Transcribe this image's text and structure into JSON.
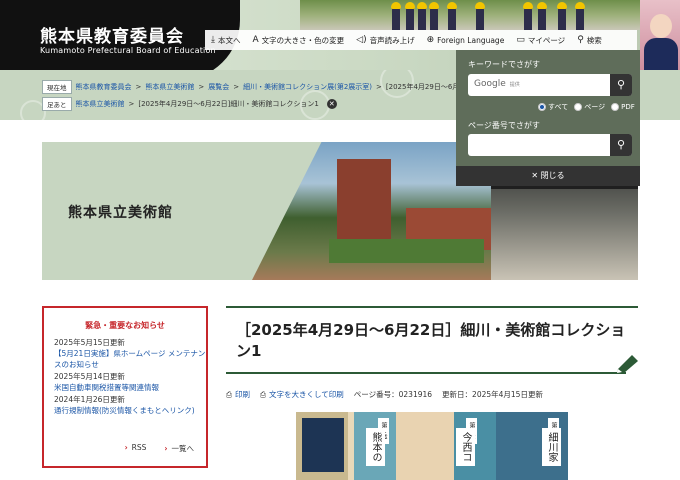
{
  "header": {
    "logo_title": "熊本県教育委員会",
    "logo_subtitle": "Kumamoto Prefectural Board of Education"
  },
  "utility": {
    "items": [
      {
        "icon": "download-icon",
        "label": "本文へ"
      },
      {
        "icon": "text-size-icon",
        "label": "文字の大きさ・色の変更"
      },
      {
        "icon": "speaker-icon",
        "label": "音声読み上げ"
      },
      {
        "icon": "globe-icon",
        "label": "Foreign Language"
      },
      {
        "icon": "folder-icon",
        "label": "マイページ"
      },
      {
        "icon": "search-icon",
        "label": "検索"
      }
    ]
  },
  "breadcrumb": {
    "current_tag": "現在地",
    "path": [
      "熊本県教育委員会",
      "熊本県立美術館",
      "展覧会",
      "細川・美術館コレクション展(第2展示室)",
      "[2025年4月29日～6月22日]細川・美術館コ"
    ],
    "history_tag": "足あと",
    "history": [
      "熊本県立美術館",
      "[2025年4月29日～6月22日]細川・美術館コレクション1"
    ]
  },
  "search_popup": {
    "keyword_label": "キーワードでさがす",
    "google_label": "Google",
    "google_sub": "提供",
    "options": [
      {
        "label": "すべて",
        "selected": true
      },
      {
        "label": "ページ",
        "selected": false
      },
      {
        "label": "PDF",
        "selected": false
      }
    ],
    "page_number_label": "ページ番号でさがす",
    "close_label": "閉じる"
  },
  "banner": {
    "title": "熊本県立美術館"
  },
  "notice": {
    "title": "緊急・重要なお知らせ",
    "items": [
      {
        "date": "2025年5月15日更新",
        "text": "【5月21日実施】県ホームページ メンテナンスのお知らせ"
      },
      {
        "date": "2025年5月14日更新",
        "text": "米国自動車関税措置等関連情報"
      },
      {
        "date": "2024年1月26日更新",
        "text": "通行規制情報(防災情報くまもとヘリンク)"
      }
    ],
    "rss_label": "RSS",
    "list_label": "一覧へ"
  },
  "article": {
    "title": "［2025年4月29日～6月22日］細川・美術館コレクション1",
    "print_label": "印刷",
    "print_large_label": "文字を大きくして印刷",
    "page_number": "ページ番号：0231916",
    "updated": "更新日：2025年4月15日更新"
  },
  "poster": {
    "labels": [
      "第１章",
      "第２章",
      "第３章"
    ],
    "big": [
      "熊本の",
      "今西コ",
      "細川家"
    ]
  },
  "colors": {
    "accent_green": "#2c5a36",
    "notice_red": "#c6262b",
    "link_blue": "#1a55a6",
    "band_green": "#c7d6c1"
  }
}
